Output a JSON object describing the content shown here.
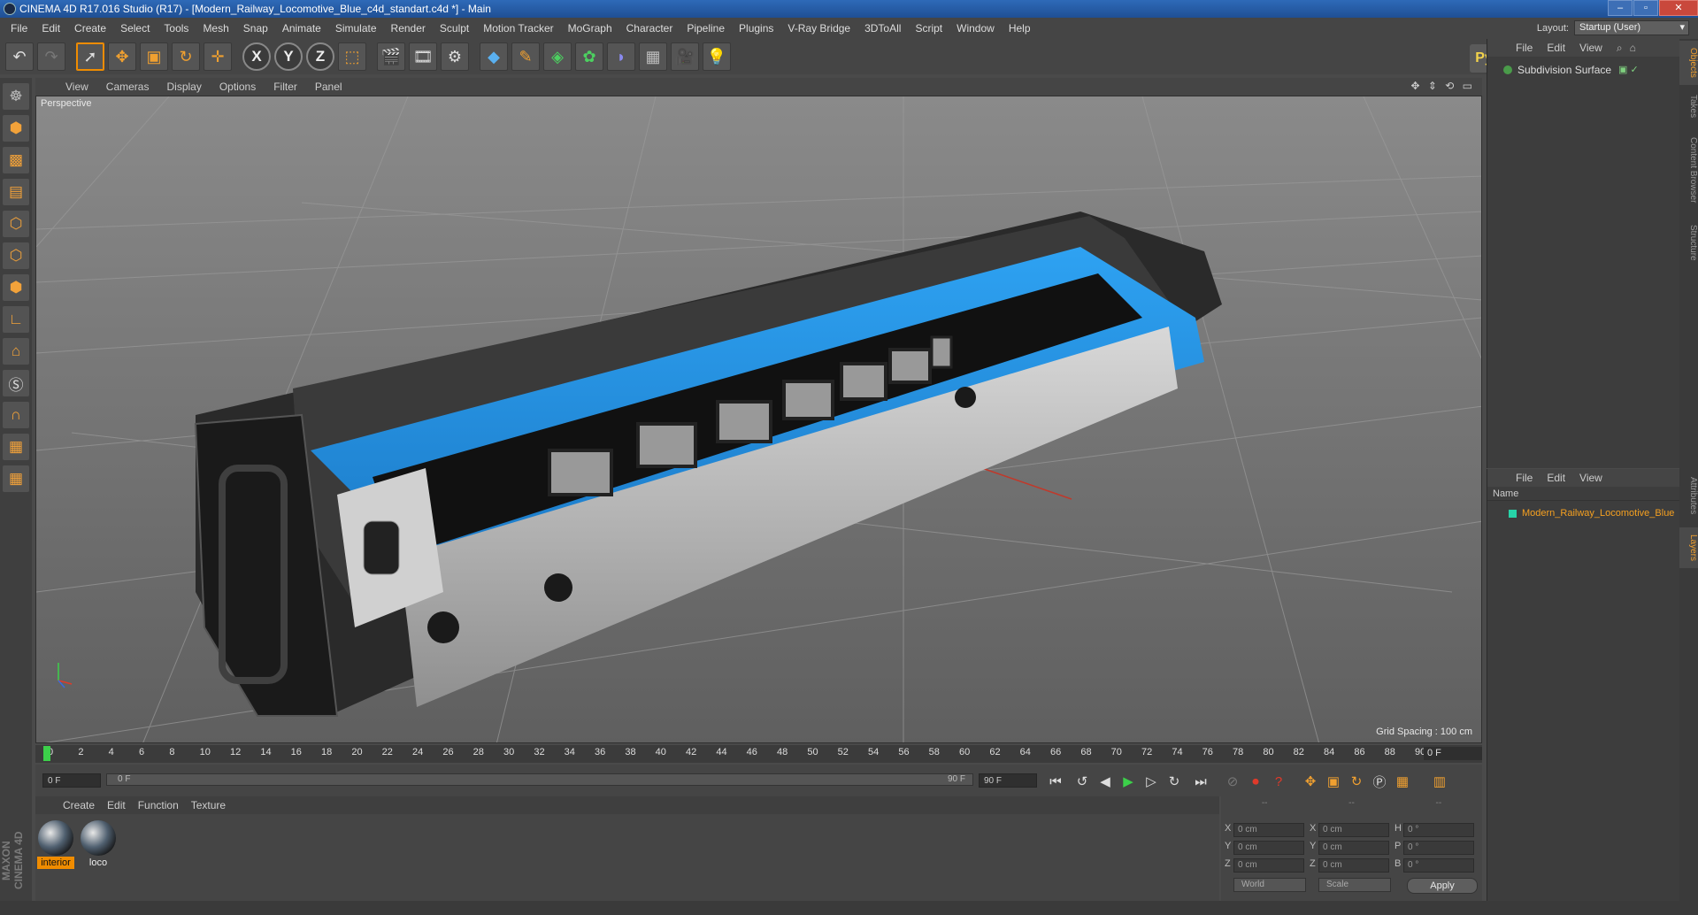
{
  "window": {
    "title": "CINEMA 4D R17.016 Studio (R17) - [Modern_Railway_Locomotive_Blue_c4d_standart.c4d *] - Main"
  },
  "menubar": [
    "File",
    "Edit",
    "Create",
    "Select",
    "Tools",
    "Mesh",
    "Snap",
    "Animate",
    "Simulate",
    "Render",
    "Sculpt",
    "Motion Tracker",
    "MoGraph",
    "Character",
    "Pipeline",
    "Plugins",
    "V-Ray Bridge",
    "3DToAll",
    "Script",
    "Window",
    "Help"
  ],
  "layout": {
    "label": "Layout:",
    "value": "Startup (User)"
  },
  "toolbar": {
    "axis_x": "X",
    "axis_y": "Y",
    "axis_z": "Z"
  },
  "viewport": {
    "menu": [
      "View",
      "Cameras",
      "Display",
      "Options",
      "Filter",
      "Panel"
    ],
    "label": "Perspective",
    "grid_spacing": "Grid Spacing : 100 cm"
  },
  "timeline": {
    "ticks": [
      "0",
      "2",
      "4",
      "6",
      "8",
      "10",
      "12",
      "14",
      "16",
      "18",
      "20",
      "22",
      "24",
      "26",
      "28",
      "30",
      "32",
      "34",
      "36",
      "38",
      "40",
      "42",
      "44",
      "46",
      "48",
      "50",
      "52",
      "54",
      "56",
      "58",
      "60",
      "62",
      "64",
      "66",
      "68",
      "70",
      "72",
      "74",
      "76",
      "78",
      "80",
      "82",
      "84",
      "86",
      "88",
      "90"
    ],
    "current_frame": "0 F",
    "start_field": "0 F",
    "slider_start": "0 F",
    "slider_end": "90 F",
    "end_field": "90 F"
  },
  "materials": {
    "menu": [
      "Create",
      "Edit",
      "Function",
      "Texture"
    ],
    "items": [
      {
        "name": "interior"
      },
      {
        "name": "loco"
      }
    ]
  },
  "coords": {
    "headers": [
      "--",
      "--",
      "--"
    ],
    "rows": [
      {
        "a": "X",
        "av": "0 cm",
        "b": "X",
        "bv": "0 cm",
        "c": "H",
        "cv": "0 °"
      },
      {
        "a": "Y",
        "av": "0 cm",
        "b": "Y",
        "bv": "0 cm",
        "c": "P",
        "cv": "0 °"
      },
      {
        "a": "Z",
        "av": "0 cm",
        "b": "Z",
        "bv": "0 cm",
        "c": "B",
        "cv": "0 °"
      }
    ],
    "world": "World",
    "scale": "Scale",
    "apply": "Apply"
  },
  "objects": {
    "menu": [
      "File",
      "Edit",
      "View"
    ],
    "item": "Subdivision Surface"
  },
  "layers": {
    "menu": [
      "File",
      "Edit",
      "View"
    ],
    "column": "Name",
    "item": "Modern_Railway_Locomotive_Blue"
  },
  "sidetabs": [
    "Objects",
    "Takes",
    "Content Browser",
    "Structure",
    "Attributes",
    "Layers"
  ],
  "brand": "MAXON CINEMA 4D",
  "colors": {
    "accent": "#f08c00",
    "train_blue": "#1f8fe0",
    "layer_swatch": "#27d3a8"
  }
}
